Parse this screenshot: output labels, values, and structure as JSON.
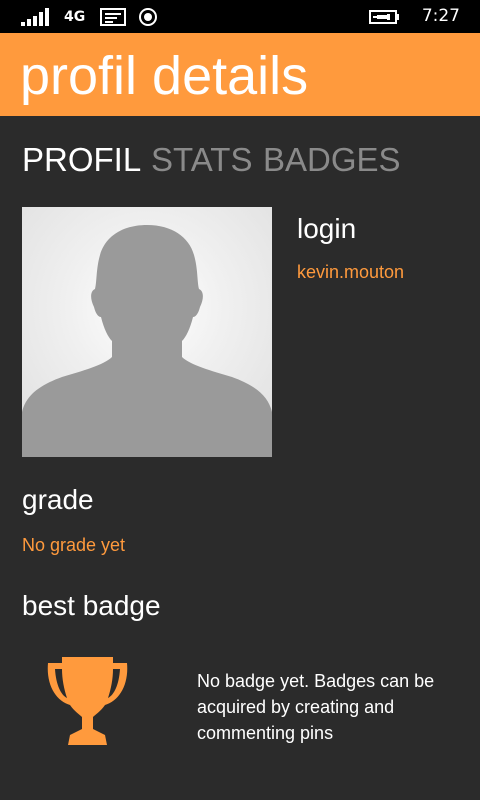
{
  "status_bar": {
    "network": "4G",
    "time": "7:27",
    "icons": [
      "signal-icon",
      "message-icon",
      "location-icon",
      "battery-charging-icon"
    ]
  },
  "header": {
    "title": "profil details",
    "accent_color": "#ff9a3d"
  },
  "tabs": [
    {
      "label": "PROFIL",
      "active": true
    },
    {
      "label": "STATS",
      "active": false
    },
    {
      "label": "BADGES",
      "active": false
    }
  ],
  "profile": {
    "avatar_icon": "person-silhouette-icon",
    "login_label": "login",
    "login_value": "kevin.mouton",
    "grade_label": "grade",
    "grade_value": "No grade yet",
    "best_badge_label": "best badge",
    "badge_icon": "trophy-icon",
    "badge_text": "No badge yet. Badges can be acquired by creating and commenting pins"
  }
}
